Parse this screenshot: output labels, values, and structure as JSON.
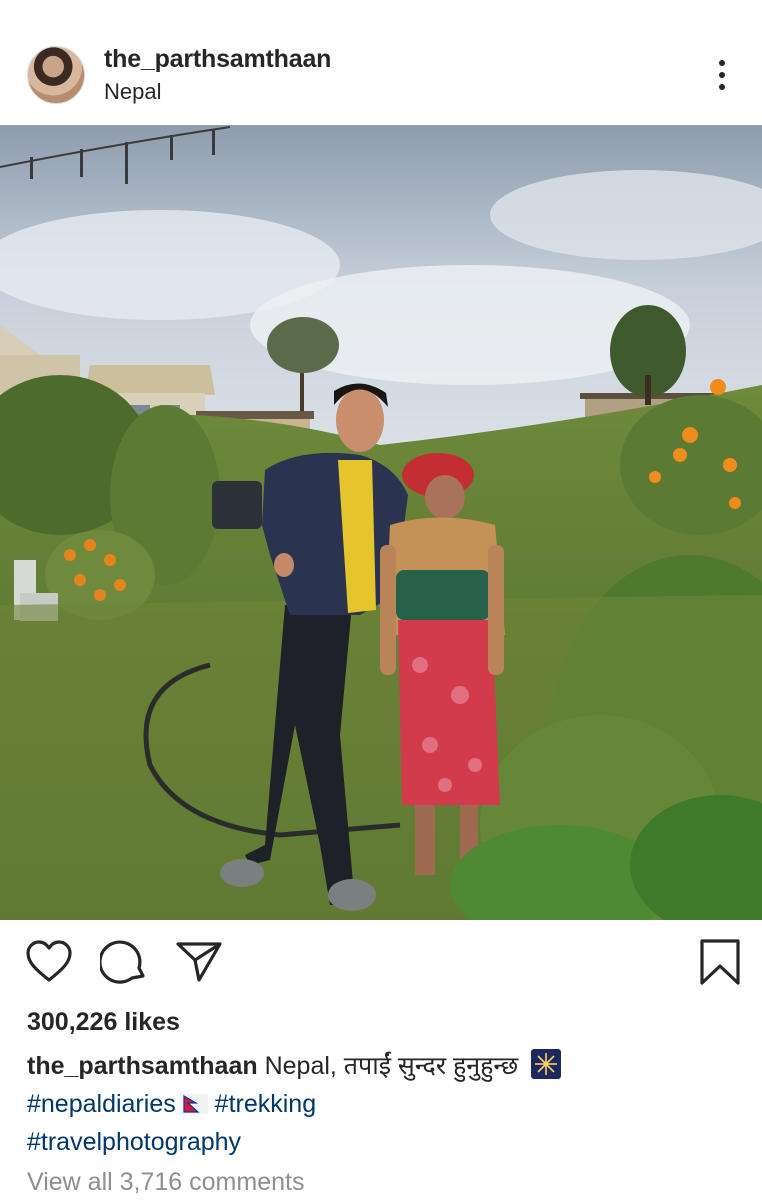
{
  "post": {
    "username": "the_parthsamthaan",
    "location": "Nepal",
    "likes": "300,226 likes",
    "caption": {
      "username": "the_parthsamthaan",
      "text": "Nepal, तपाईं सुन्दर हुनुहुन्छ",
      "hashtag_1": "#nepaldiaries",
      "hashtag_2": "#trekking",
      "hashtag_3": "#travelphotography"
    },
    "view_comments": "View all 3,716 comments"
  },
  "icons": {
    "like": "heart-icon",
    "comment": "comment-icon",
    "share": "paper-plane-icon",
    "save": "bookmark-icon",
    "more": "more-vertical-icon"
  },
  "colors": {
    "text": "#262626",
    "hashtag": "#00376b",
    "muted": "#8e8e8e"
  }
}
